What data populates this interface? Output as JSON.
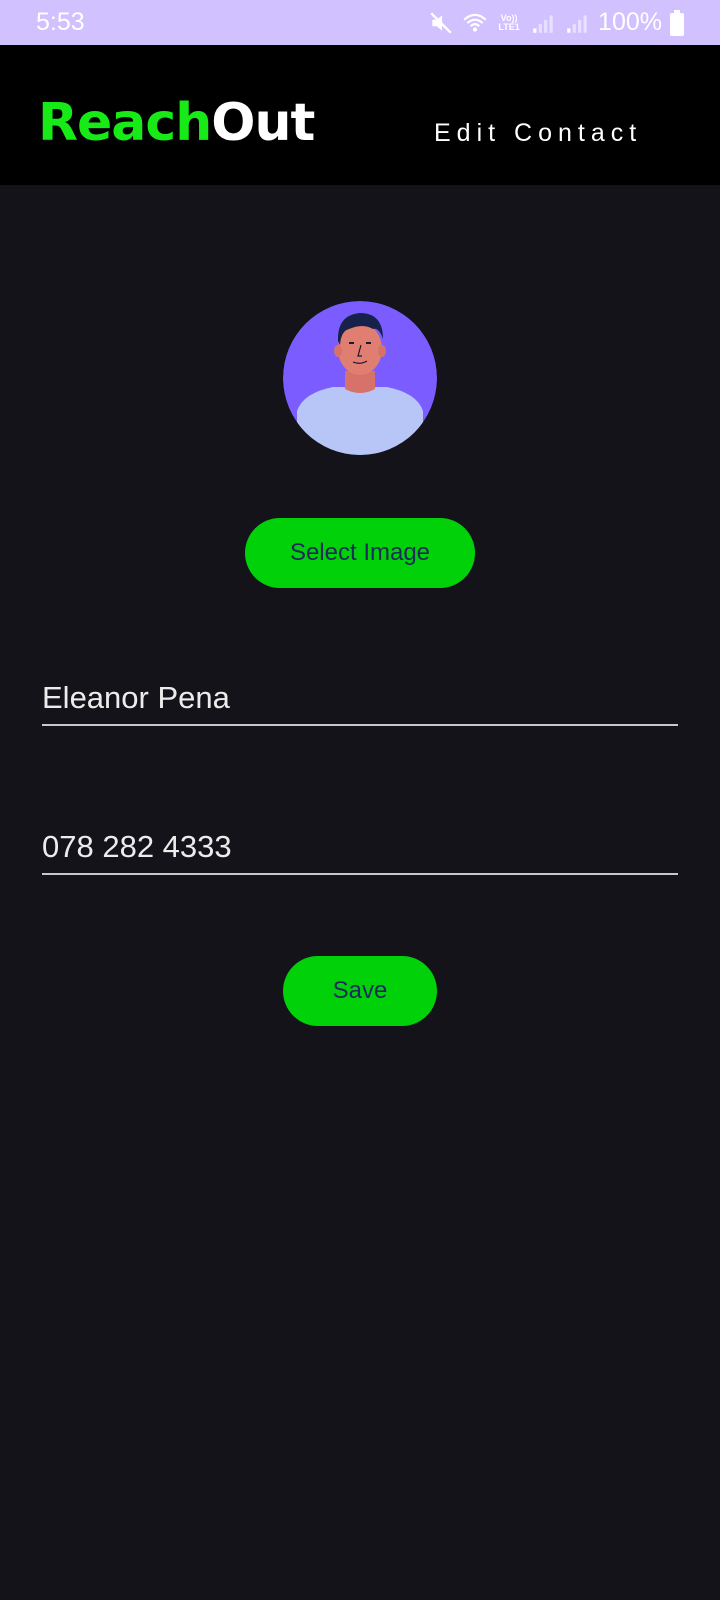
{
  "status_bar": {
    "time": "5:53",
    "battery": "100%",
    "volte_top": "Vo))",
    "volte_bottom": "LTE1",
    "icons": [
      "mute-icon",
      "wifi-icon",
      "volte-icon",
      "signal-icon",
      "signal-icon",
      "battery-icon"
    ]
  },
  "app_bar": {
    "logo_part1": "Reach",
    "logo_part2": "Out",
    "title": "Edit Contact"
  },
  "form": {
    "select_image_label": "Select Image",
    "name_value": "Eleanor Pena",
    "phone_value": "078 282 4333",
    "save_label": "Save"
  },
  "colors": {
    "status_bar": "#d1c1ff",
    "app_bar": "#000000",
    "background": "#15131a",
    "accent_green": "#00d108",
    "logo_green": "#17ea17",
    "avatar_bg": "#7b5cff"
  }
}
